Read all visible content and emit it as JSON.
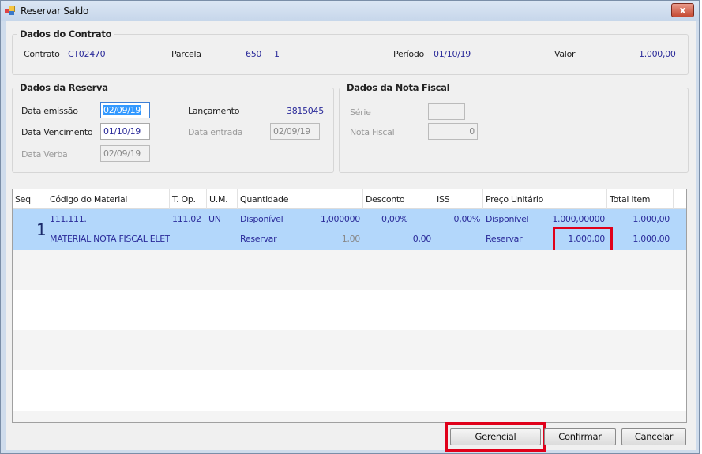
{
  "window": {
    "title": "Reservar Saldo",
    "close_label": "x"
  },
  "contrato": {
    "title": "Dados do Contrato",
    "contrato_label": "Contrato",
    "contrato_value": "CT02470",
    "parcela_label": "Parcela",
    "parcela_value1": "650",
    "parcela_value2": "1",
    "periodo_label": "Período",
    "periodo_value": "01/10/19",
    "valor_label": "Valor",
    "valor_value": "1.000,00"
  },
  "reserva": {
    "title": "Dados da Reserva",
    "data_emissao_label": "Data emissão",
    "data_emissao_value": "02/09/19",
    "data_vencimento_label": "Data Vencimento",
    "data_vencimento_value": "01/10/19",
    "data_verba_label": "Data Verba",
    "data_verba_value": "02/09/19",
    "lancamento_label": "Lançamento",
    "lancamento_value": "3815045",
    "data_entrada_label": "Data entrada",
    "data_entrada_value": "02/09/19"
  },
  "nota_fiscal": {
    "title": "Dados da Nota Fiscal",
    "serie_label": "Série",
    "serie_value": "",
    "nota_label": "Nota Fiscal",
    "nota_value": "0"
  },
  "grid": {
    "columns": [
      "Seq",
      "Código do Material",
      "T. Op.",
      "U.M.",
      "Quantidade",
      "Desconto",
      "ISS",
      "Preço Unitário",
      "Total Item"
    ],
    "row": {
      "seq": "1",
      "codigo": "111.111.",
      "descricao": "MATERIAL NOTA FISCAL ELETR(",
      "top": "111.02",
      "um": "UN",
      "qtd_disp_label": "Disponível",
      "qtd_disp": "1,000000",
      "qtd_res_label": "Reservar",
      "qtd_res": "1,00",
      "desconto_pct": "0,00%",
      "desconto_val": "0,00",
      "iss": "0,00%",
      "preco_disp_label": "Disponível",
      "preco_disp": "1.000,00000",
      "preco_res_label": "Reservar",
      "preco_res": "1.000,00",
      "total1": "1.000,00",
      "total2": "1.000,00"
    }
  },
  "buttons": {
    "gerencial": "Gerencial",
    "confirmar": "Confirmar",
    "cancelar": "Cancelar"
  },
  "colors": {
    "selected_row": "#b3d7fb",
    "highlight": "#e0001a"
  }
}
